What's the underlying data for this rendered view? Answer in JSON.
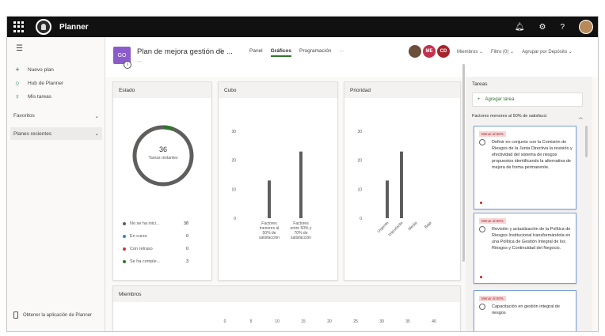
{
  "app": {
    "name": "Planner"
  },
  "topbar": {
    "bell_icon": "bell-icon",
    "settings_icon": "gear-icon",
    "help_label": "?"
  },
  "leftnav": {
    "items": [
      {
        "label": "Nuevo plan",
        "icon": "+"
      },
      {
        "label": "Hub de Planner",
        "icon": "○"
      },
      {
        "label": "Mis tareas",
        "icon": "♀"
      }
    ],
    "sections": [
      {
        "label": "Favoritos",
        "chevron": "⌄"
      },
      {
        "label": "Planes recientes",
        "chevron": "⌄"
      }
    ],
    "bottom_link": "Obtener la aplicación de Planner"
  },
  "plan": {
    "icon_text": "GO",
    "title": "Plan de mejora gestión de ...",
    "subtitle": "...",
    "tabs": [
      "Panel",
      "Gráficos",
      "Programación",
      "···"
    ],
    "active_tab": "Gráficos",
    "avatars": [
      {
        "initials": "",
        "color": "#6b4f3a"
      },
      {
        "initials": "ME",
        "color": "#c4314b"
      },
      {
        "initials": "CD",
        "color": "#a4262c"
      }
    ],
    "filters": [
      "Miembros ⌄",
      "Filtro (0) ⌄",
      "Agrupar por Depósito ⌄"
    ]
  },
  "estado": {
    "title": "Estado",
    "center_number": "36",
    "center_label": "Tareas restantes",
    "legend": [
      {
        "label": "No se ha inici...",
        "value": "38",
        "color": "#605e5c"
      },
      {
        "label": "En curso",
        "value": "0",
        "color": "#2b88d8"
      },
      {
        "label": "Con retraso",
        "value": "0",
        "color": "#d13438"
      },
      {
        "label": "Se ha comple...",
        "value": "3",
        "color": "#31752f"
      }
    ]
  },
  "cubo": {
    "title": "Cubo",
    "chart_data": {
      "type": "bar",
      "categories": [
        "Factores menores al 50% de satisfacción",
        "Factores entre 50% y 70% de satisfacción"
      ],
      "values": [
        13,
        23
      ],
      "ylim": [
        0,
        30
      ],
      "yticks": [
        "0",
        "10",
        "20",
        "30"
      ]
    }
  },
  "prioridad": {
    "title": "Prioridad",
    "chart_data": {
      "type": "bar",
      "categories": [
        "Urgente",
        "Importante",
        "Media",
        "Baja"
      ],
      "values": [
        13,
        23,
        0,
        0
      ],
      "ylim": [
        0,
        30
      ],
      "yticks": [
        "0",
        "10",
        "20",
        "30"
      ]
    }
  },
  "miembros": {
    "title": "Miembros",
    "xticks": [
      "0",
      "5",
      "10",
      "15",
      "20",
      "25",
      "30",
      "35",
      "40"
    ]
  },
  "tasks": {
    "title": "Tareas",
    "add_label": "Agregar tarea",
    "group_label": "Factores menores al 50% de satisfacci",
    "cards": [
      {
        "tag": "Menor al 50%",
        "text": "Definir en conjunto con la Comisión de Riesgos de la Junta Directiva la revisión y efectividad del sistema de riesgos propuestos identificando la alternativa de mejora de forma permanente."
      },
      {
        "tag": "Menor al 50%",
        "text": "Revisión y actualización de la Política de Riesgos Institucional transformándola en una Política de Gestión Integral de los Riesgos y Continuidad del Negocio."
      },
      {
        "tag": "Menor al 50%",
        "text": "Capacitación en gestión integral de riesgos"
      }
    ]
  }
}
